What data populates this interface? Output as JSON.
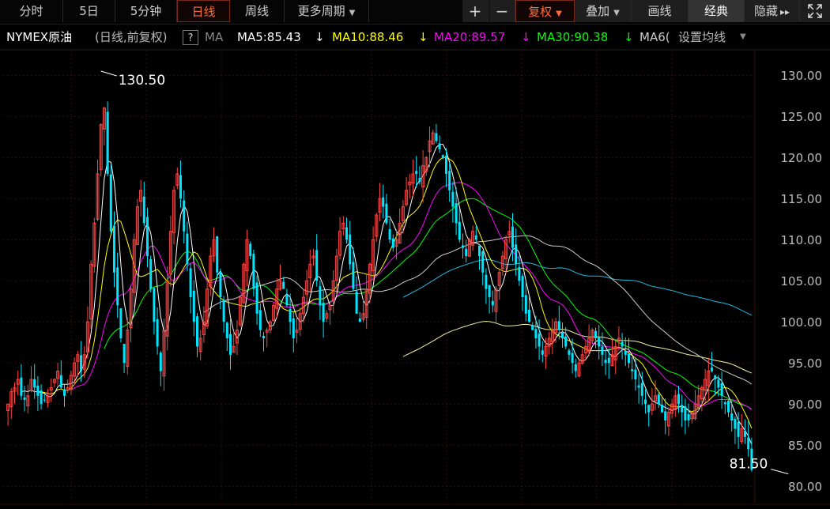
{
  "toolbar": {
    "tabs": [
      {
        "label": "分时",
        "active": false
      },
      {
        "label": "5日",
        "active": false
      },
      {
        "label": "5分钟",
        "active": false
      },
      {
        "label": "日线",
        "active": true
      },
      {
        "label": "周线",
        "active": false
      },
      {
        "label": "更多周期",
        "active": false,
        "dropdown": true
      }
    ],
    "zoom_in": "+",
    "zoom_out": "−",
    "fuquan": "复权",
    "overlay": "叠加",
    "draw": "画线",
    "classic": "经典",
    "hide": "隐藏",
    "hide_arrow": "▸▸",
    "fullscreen_icon": "fullscreen-icon"
  },
  "legend": {
    "name": "NYMEX原油",
    "mode": "(日线,前复权)",
    "help": "?",
    "ma_label": "MA",
    "ma5": "MA5:85.43",
    "ma10": "MA10:88.46",
    "ma20": "MA20:89.57",
    "ma30": "MA30:90.38",
    "ma60": "MA6(",
    "settings": "设置均线",
    "down_arrow": "↓"
  },
  "colors": {
    "up": "#ff4444",
    "down": "#00e5ff",
    "ma5": "#ffffff",
    "ma10": "#ffff00",
    "ma20": "#ff00ff",
    "ma30": "#00ff00",
    "ma60": "#cccccc",
    "ma120": "#20b8e0",
    "ma250": "#f4f0a0",
    "grid": "#3a0a0a",
    "accent": "#ff6a3d"
  },
  "chart_data": {
    "type": "candlestick",
    "ylim": [
      78,
      133
    ],
    "y_ticks": [
      "80.00",
      "85.00",
      "90.00",
      "95.00",
      "100.00",
      "105.00",
      "110.00",
      "115.00",
      "120.00",
      "125.00",
      "130.00"
    ],
    "y_values": [
      80,
      85,
      90,
      95,
      100,
      105,
      110,
      115,
      120,
      125,
      130
    ],
    "annotations": [
      {
        "label": "130.50",
        "value": 130.5,
        "index": 28
      },
      {
        "label": "81.50",
        "value": 81.5,
        "index": 236
      }
    ],
    "closes": [
      90,
      91.5,
      92,
      93,
      91,
      90.5,
      91,
      93,
      92,
      91,
      90,
      90.5,
      91,
      92,
      93,
      94,
      92,
      91,
      92,
      93.5,
      95,
      96,
      94,
      96,
      100,
      107,
      112,
      118,
      124,
      126,
      118,
      111,
      106,
      102,
      98,
      95,
      99,
      104,
      110,
      114,
      116,
      112,
      108,
      104,
      100,
      97,
      94,
      99,
      105,
      111,
      116,
      118,
      115,
      111,
      107,
      103,
      100,
      97,
      98,
      100,
      104,
      108,
      110,
      106,
      103,
      100,
      98,
      96,
      97,
      99,
      103,
      107,
      110,
      108,
      104,
      101,
      99,
      98,
      99,
      100,
      102,
      104,
      105,
      104,
      102,
      100,
      98,
      99,
      101,
      103,
      105,
      107,
      108,
      105,
      102,
      100,
      101,
      102,
      105,
      108,
      111,
      112,
      110,
      107,
      104,
      101,
      100,
      101,
      104,
      107,
      110,
      113,
      115,
      114,
      112,
      110,
      109,
      110,
      112,
      114,
      116,
      117,
      118,
      118,
      117,
      119,
      120,
      122,
      123,
      122,
      121,
      120,
      118,
      116,
      114,
      112,
      110,
      109,
      108,
      110,
      111,
      110,
      108,
      106,
      104,
      103,
      102,
      104,
      106,
      108,
      110,
      111,
      109,
      107,
      105,
      103,
      101,
      100,
      99,
      98,
      97,
      96,
      97,
      98,
      99,
      100,
      99,
      98,
      97,
      96,
      95,
      94,
      95,
      96,
      97,
      98,
      99,
      98,
      97,
      96,
      95,
      95,
      96,
      97,
      98,
      97,
      96,
      95,
      94,
      93,
      92,
      91,
      90,
      89,
      90,
      91,
      90,
      89,
      88,
      89,
      90,
      91,
      90,
      89,
      88,
      88,
      89,
      90,
      91,
      92,
      93,
      94,
      94,
      93,
      92,
      91,
      90,
      89,
      88,
      87,
      86,
      87,
      86,
      84.5,
      82
    ]
  }
}
